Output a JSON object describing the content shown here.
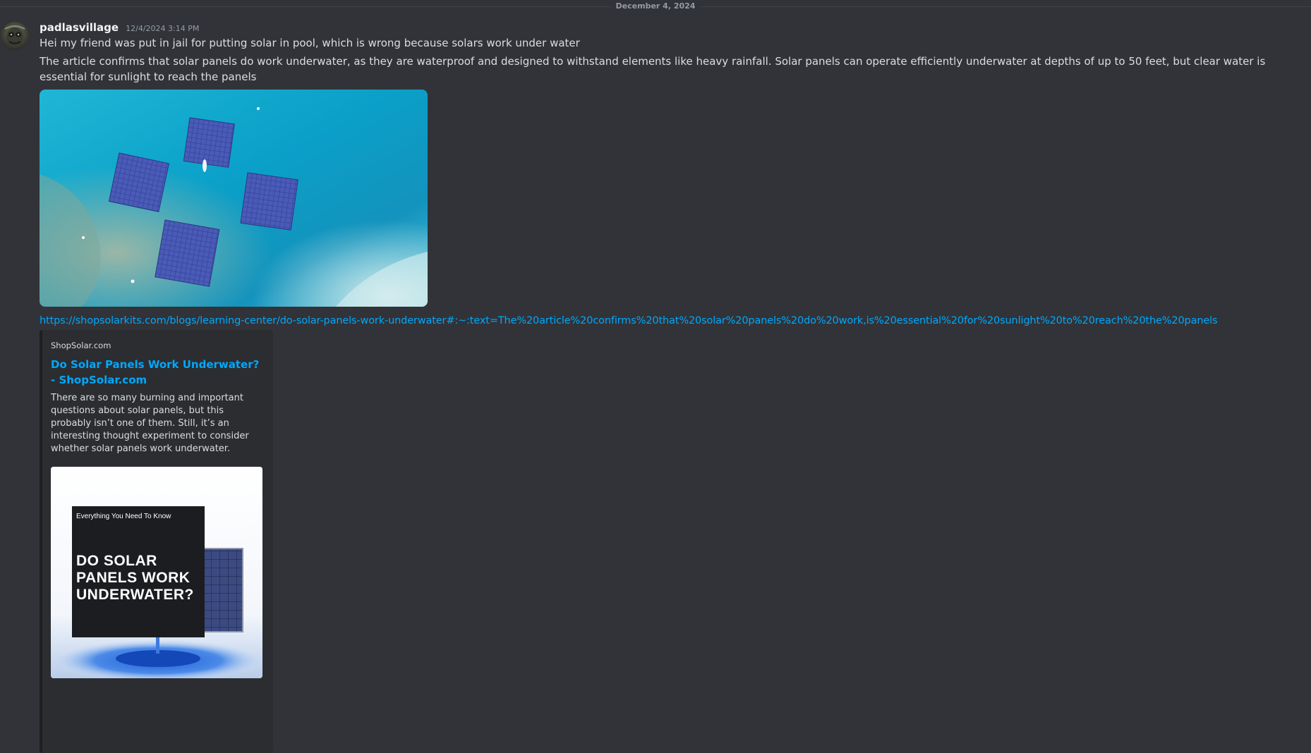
{
  "divider": {
    "date": "December 4, 2024"
  },
  "message": {
    "username": "padlasvillage",
    "timestamp": "12/4/2024 3:14 PM",
    "line1": "Hei my friend was put in jail for putting solar in pool, which is wrong because solars work under water",
    "line2": "The article confirms that solar panels do work underwater, as they are waterproof and designed to withstand elements like heavy rainfall. Solar panels can operate efficiently underwater at depths of up to 50 feet, but clear water is essential for sunlight to reach the panels",
    "link": "https://shopsolarkits.com/blogs/learning-center/do-solar-panels-work-underwater#:~:text=The%20article%20confirms%20that%20solar%20panels%20do%20work,is%20essential%20for%20sunlight%20to%20reach%20the%20panels"
  },
  "embed": {
    "provider": "ShopSolar.com",
    "title": "Do Solar Panels Work Underwater? - ShopSolar.com",
    "description": "There are so many burning and important questions about solar panels, but this probably isn’t one of them. Still, it’s an interesting thought experiment to consider whether solar panels work underwater.",
    "image": {
      "kicker": "Everything You Need To Know",
      "headline": "DO SOLAR PANELS WORK UNDERWATER?"
    }
  },
  "colors": {
    "background": "#313338",
    "link": "#00a8fc",
    "embed_bg": "#2b2d31"
  }
}
